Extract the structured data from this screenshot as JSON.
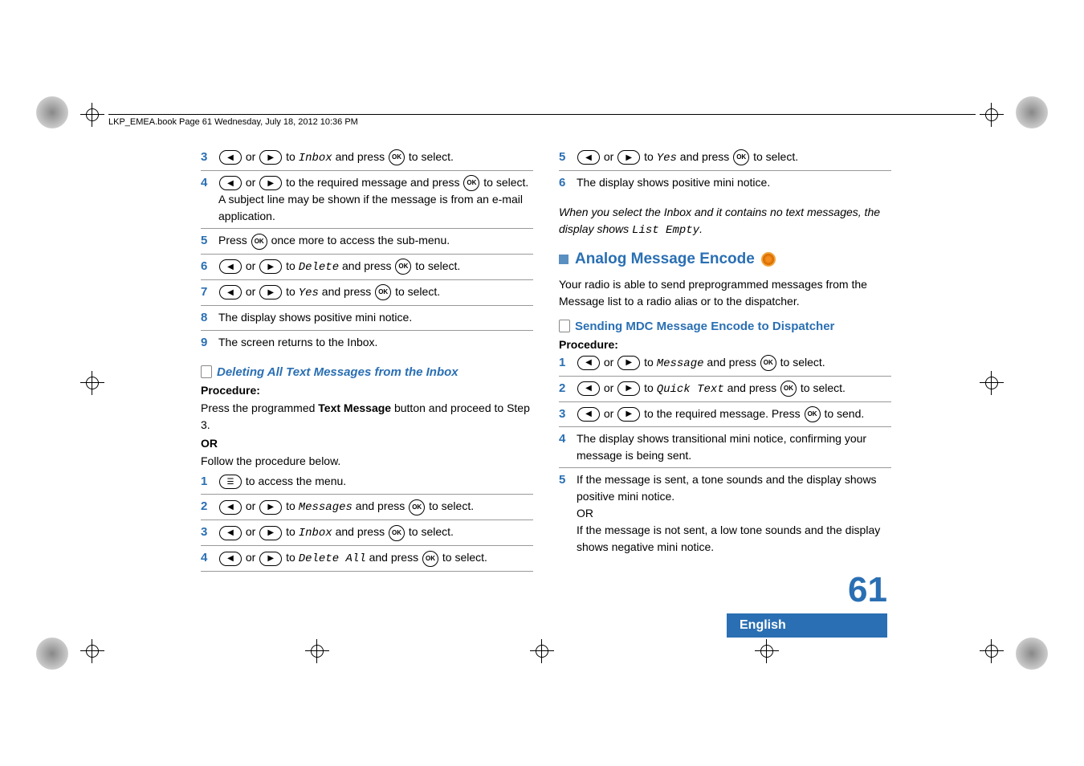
{
  "header": "LKP_EMEA.book  Page 61  Wednesday, July 18, 2012  10:36 PM",
  "left": {
    "steps_a": [
      {
        "n": "3",
        "pre": "",
        "mid": "Inbox",
        "post": " and press ",
        "tail": " to select.",
        "type": "nav-ok"
      },
      {
        "n": "4",
        "pre": "",
        "mid": "",
        "post": " to the required message and press ",
        "tail": " to select.",
        "extra": "A subject line may be shown if the message is from an e-mail application.",
        "type": "nav-ok-plain"
      },
      {
        "n": "5",
        "text_a": "Press ",
        "text_b": " once more to access the sub-menu.",
        "type": "ok-only"
      },
      {
        "n": "6",
        "pre": "",
        "mid": "Delete",
        "post": " and press ",
        "tail": " to select.",
        "type": "nav-ok"
      },
      {
        "n": "7",
        "pre": "",
        "mid": "Yes",
        "post": " and press ",
        "tail": " to select.",
        "type": "nav-ok"
      },
      {
        "n": "8",
        "plain": "The display shows positive mini notice.",
        "type": "plain"
      },
      {
        "n": "9",
        "plain": "The screen returns to the Inbox.",
        "type": "plain-noborder"
      }
    ],
    "subheading": "Deleting All Text Messages from the Inbox",
    "procedure_label": "Procedure:",
    "press_text_a": "Press the programmed ",
    "press_bold": "Text Message",
    "press_text_b": " button and proceed to Step 3.",
    "or": "OR",
    "follow": "Follow the procedure below.",
    "steps_b": [
      {
        "n": "1",
        "text_a": "",
        "text_b": " to access the menu.",
        "type": "menu-btn"
      },
      {
        "n": "2",
        "pre": "",
        "mid": "Messages",
        "post": " and press ",
        "tail": " to select.",
        "type": "nav-ok"
      },
      {
        "n": "3",
        "pre": "",
        "mid": "Inbox",
        "post": " and press ",
        "tail": " to select.",
        "type": "nav-ok"
      },
      {
        "n": "4",
        "pre": "",
        "mid": "Delete All",
        "post": " and press ",
        "tail": " to select.",
        "type": "nav-ok"
      }
    ]
  },
  "right": {
    "steps_c": [
      {
        "n": "5",
        "pre": "",
        "mid": "Yes",
        "post": " and press ",
        "tail": " to select.",
        "type": "nav-ok"
      },
      {
        "n": "6",
        "plain": "The display shows positive mini notice.",
        "type": "plain-noborder"
      }
    ],
    "note_a": "When you select the Inbox and it contains no text messages, the display shows ",
    "note_mono": "List Empty",
    "note_b": ".",
    "section_title": "Analog Message Encode",
    "section_desc": "Your radio is able to send preprogrammed messages from the Message list to a radio alias or to the dispatcher.",
    "sub_title": "Sending MDC Message Encode to Dispatcher",
    "procedure_label": "Procedure:",
    "steps_d": [
      {
        "n": "1",
        "pre": "",
        "mid": "Message",
        "post": " and press ",
        "tail": " to select.",
        "type": "nav-ok"
      },
      {
        "n": "2",
        "pre": "",
        "mid": "Quick Text",
        "post": " and press ",
        "tail": " to select.",
        "type": "nav-ok"
      },
      {
        "n": "3",
        "pre": "",
        "mid": "",
        "post": " to the required message. Press ",
        "tail": " to send.",
        "type": "nav-ok-plain"
      },
      {
        "n": "4",
        "plain": " The display shows transitional mini notice, confirming your message is being sent.",
        "type": "plain"
      },
      {
        "n": "5",
        "plain_a": "If the message is sent, a tone sounds and the display shows positive mini notice.",
        "plain_or": "OR",
        "plain_b": "If the message is not sent, a low tone sounds and the display shows negative mini notice.",
        "type": "plain-multi-noborder"
      }
    ]
  },
  "page_number": "61",
  "language": "English"
}
